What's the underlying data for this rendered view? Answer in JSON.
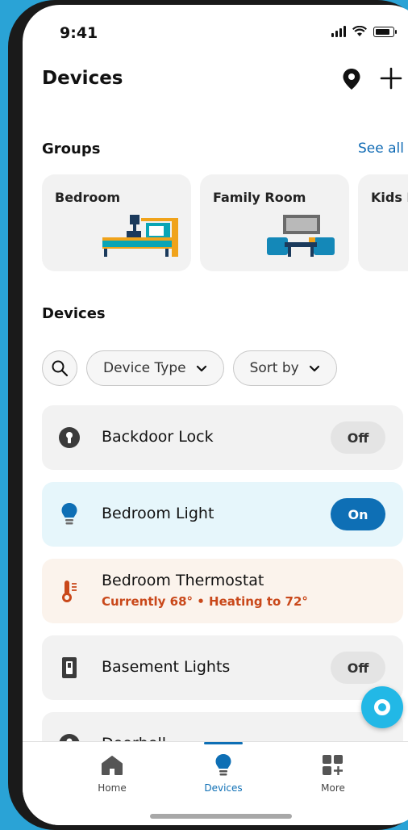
{
  "status_bar": {
    "time": "9:41"
  },
  "header": {
    "title": "Devices"
  },
  "groups": {
    "title": "Groups",
    "see_all": "See all",
    "items": [
      {
        "label": "Bedroom"
      },
      {
        "label": "Family Room"
      },
      {
        "label": "Kids Be"
      }
    ]
  },
  "devices": {
    "title": "Devices",
    "filters": {
      "device_type": "Device Type",
      "sort_by": "Sort by"
    },
    "items": [
      {
        "name": "Backdoor Lock",
        "toggle": "Off",
        "icon": "lock-icon"
      },
      {
        "name": "Bedroom Light",
        "toggle": "On",
        "icon": "bulb-icon"
      },
      {
        "name": "Bedroom Thermostat",
        "status": "Currently 68° • Heating to 72°",
        "icon": "thermostat-icon"
      },
      {
        "name": "Basement Lights",
        "toggle": "Off",
        "icon": "light-switch-icon"
      },
      {
        "name": "Doorbell",
        "icon": "doorbell-icon"
      }
    ]
  },
  "bottom_nav": {
    "items": [
      {
        "label": "Home",
        "icon": "home-icon"
      },
      {
        "label": "Devices",
        "icon": "bulb-icon"
      },
      {
        "label": "More",
        "icon": "more-grid-icon"
      }
    ],
    "active": "Devices"
  },
  "colors": {
    "accent": "#0e6fb5",
    "on_card": "#e6f6fb",
    "heat_card": "#fbf3ec",
    "heat_text": "#c9481a",
    "alexa": "#22b8e6",
    "background": "#2aa3d6"
  }
}
